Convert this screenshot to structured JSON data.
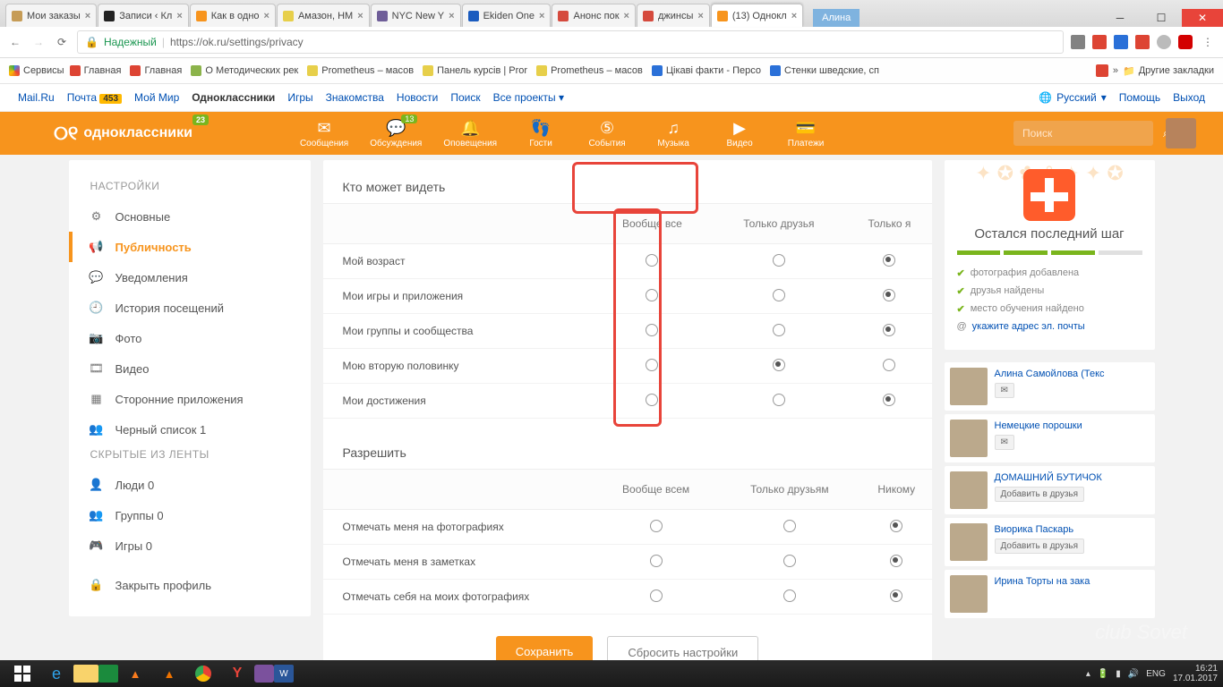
{
  "chrome": {
    "user": "Алина",
    "tabs": [
      {
        "label": "Мои заказы",
        "icon": "#c69c56"
      },
      {
        "label": "Записи ‹ Кл",
        "icon": "#222"
      },
      {
        "label": "Как в одно",
        "icon": "#f7941d"
      },
      {
        "label": "Амазон, НМ",
        "icon": "#e7cf4a"
      },
      {
        "label": "NYC New Y",
        "icon": "#6e5d98"
      },
      {
        "label": "Ekiden One",
        "icon": "#1a5bbf"
      },
      {
        "label": "Анонс пок",
        "icon": "#d54a3d"
      },
      {
        "label": "джинсы",
        "icon": "#d54a3d"
      },
      {
        "label": "(13) Однокл",
        "icon": "#f7941d",
        "active": true
      }
    ],
    "secure": "Надежный",
    "url": "https://ok.ru/settings/privacy"
  },
  "bookmarks": {
    "services": "Сервисы",
    "items": [
      {
        "label": "Главная",
        "c": "#d43"
      },
      {
        "label": "Главная",
        "c": "#d43"
      },
      {
        "label": "О Методических рек",
        "c": "#8bb34a"
      },
      {
        "label": "Prometheus – масов",
        "c": "#e7cf4a"
      },
      {
        "label": "Панель курсів | Pror",
        "c": "#e7cf4a"
      },
      {
        "label": "Prometheus – масов",
        "c": "#e7cf4a"
      },
      {
        "label": "Цікаві факти - Персо",
        "c": "#2a70d8"
      },
      {
        "label": "Стенки шведские, сп",
        "c": "#2a70d8"
      }
    ],
    "other": "Другие закладки"
  },
  "mail": {
    "items": [
      "Mail.Ru",
      "Почта",
      "Мой Мир",
      "Одноклассники",
      "Игры",
      "Знакомства",
      "Новости",
      "Поиск",
      "Все проекты"
    ],
    "badge": "453",
    "lang": "Русский",
    "help": "Помощь",
    "exit": "Выход"
  },
  "ok_nav": {
    "brand": "одноклассники",
    "brand_badge": "23",
    "items": [
      {
        "label": "Сообщения",
        "ic": "✉"
      },
      {
        "label": "Обсуждения",
        "ic": "💬",
        "badge": "13"
      },
      {
        "label": "Оповещения",
        "ic": "🔔"
      },
      {
        "label": "Гости",
        "ic": "👣"
      },
      {
        "label": "События",
        "ic": "⑤"
      },
      {
        "label": "Музыка",
        "ic": "♫"
      },
      {
        "label": "Видео",
        "ic": "▶"
      },
      {
        "label": "Платежи",
        "ic": "💳"
      }
    ],
    "search": "Поиск"
  },
  "sidebar": {
    "title": "НАСТРОЙКИ",
    "items": [
      {
        "ic": "⚙",
        "label": "Основные"
      },
      {
        "ic": "📢",
        "label": "Публичность",
        "active": true
      },
      {
        "ic": "💬",
        "label": "Уведомления"
      },
      {
        "ic": "🕘",
        "label": "История посещений"
      },
      {
        "ic": "📷",
        "label": "Фото"
      },
      {
        "ic": "🎞",
        "label": "Видео"
      },
      {
        "ic": "▦",
        "label": "Сторонние приложения"
      },
      {
        "ic": "👥",
        "label": "Черный список 1"
      }
    ],
    "title2": "СКРЫТЫЕ ИЗ ЛЕНТЫ",
    "items2": [
      {
        "ic": "👤",
        "label": "Люди 0"
      },
      {
        "ic": "👥",
        "label": "Группы 0"
      },
      {
        "ic": "🎮",
        "label": "Игры 0"
      }
    ],
    "lock": {
      "ic": "🔒",
      "label": "Закрыть профиль"
    }
  },
  "privacy": {
    "h1": "Кто может видеть",
    "cols1": [
      "Вообще все",
      "Только друзья",
      "Только я"
    ],
    "rows1": [
      {
        "label": "Мой возраст",
        "sel": 2
      },
      {
        "label": "Мои игры и приложения",
        "sel": 2
      },
      {
        "label": "Мои группы и сообщества",
        "sel": 2
      },
      {
        "label": "Мою вторую половинку",
        "sel": 1
      },
      {
        "label": "Мои достижения",
        "sel": 2
      }
    ],
    "h2": "Разрешить",
    "cols2": [
      "Вообще всем",
      "Только друзьям",
      "Никому"
    ],
    "rows2": [
      {
        "label": "Отмечать меня на фотографиях",
        "sel": 2
      },
      {
        "label": "Отмечать меня в заметках",
        "sel": 2
      },
      {
        "label": "Отмечать себя на моих фотографиях",
        "sel": 2
      }
    ],
    "save": "Сохранить",
    "reset": "Сбросить настройки"
  },
  "promo": {
    "title": "Остался последний шаг",
    "checks": [
      {
        "done": true,
        "label": "фотография добавлена"
      },
      {
        "done": true,
        "label": "друзья найдены"
      },
      {
        "done": true,
        "label": "место обучения найдено"
      },
      {
        "done": false,
        "label": "укажите адрес эл. почты"
      }
    ]
  },
  "friends": [
    {
      "name": "Алина Самойлова (Текс",
      "btn": "✉"
    },
    {
      "name": "Немецкие порошки",
      "btn": "✉"
    },
    {
      "name": "ДОМАШНИЙ БУТИЧОК",
      "btn": "Добавить в друзья"
    },
    {
      "name": "Виорика Паскарь",
      "btn": "Добавить в друзья"
    },
    {
      "name": "Ирина Торты на зака",
      "btn": ""
    }
  ],
  "task": {
    "lang": "ENG",
    "time": "16:21",
    "date": "17.01.2017"
  },
  "watermark": "club Sovet"
}
